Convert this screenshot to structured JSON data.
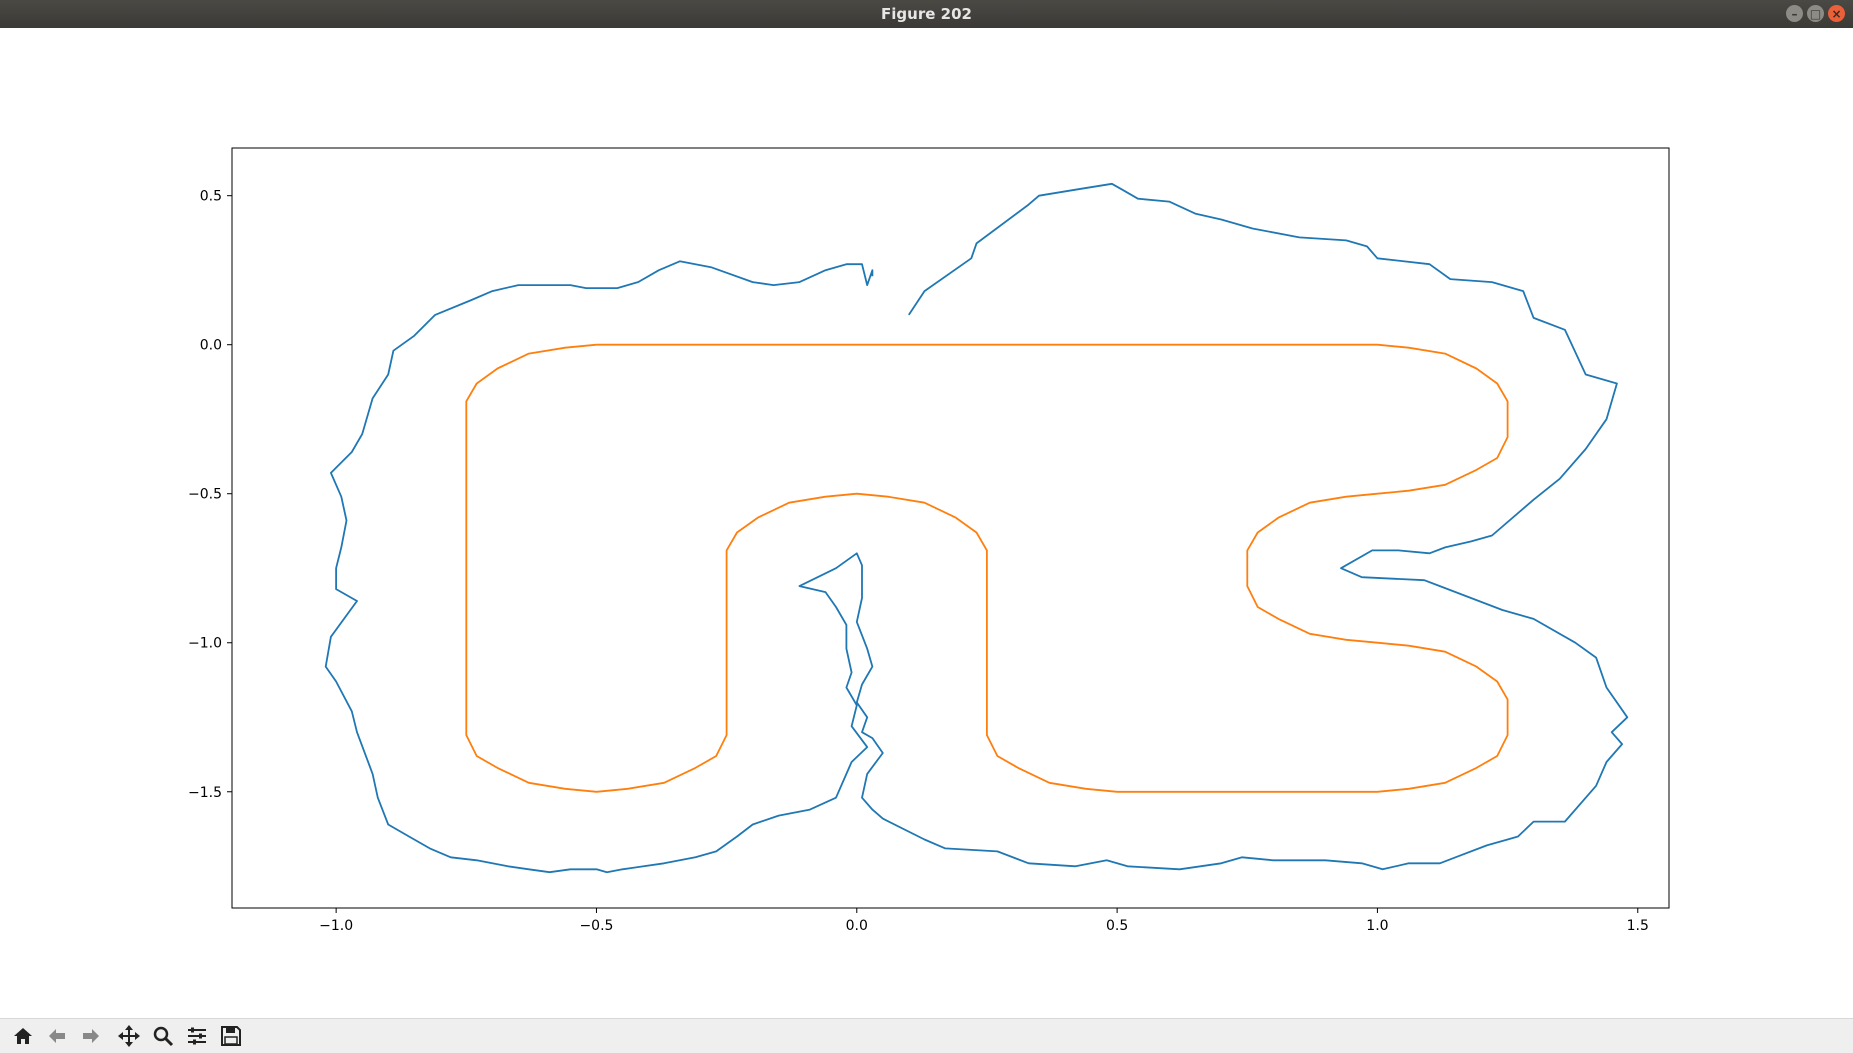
{
  "window": {
    "title": "Figure 202"
  },
  "toolbar": {
    "buttons": [
      {
        "name": "home-icon"
      },
      {
        "name": "back-arrow-icon"
      },
      {
        "name": "forward-arrow-icon"
      },
      {
        "name": "pan-move-icon"
      },
      {
        "name": "zoom-magnifier-icon"
      },
      {
        "name": "configure-subplots-icon"
      },
      {
        "name": "save-figure-icon"
      }
    ]
  },
  "chart_data": {
    "type": "line",
    "title": "",
    "xlabel": "",
    "ylabel": "",
    "xlim": [
      -1.2,
      1.56
    ],
    "ylim": [
      -1.89,
      0.66
    ],
    "xticks": [
      -1.0,
      -0.5,
      0.0,
      0.5,
      1.0,
      1.5
    ],
    "xtick_labels": [
      "−1.0",
      "−0.5",
      "0.0",
      "0.5",
      "1.0",
      "1.5"
    ],
    "yticks": [
      0.5,
      0.0,
      -0.5,
      -1.0,
      -1.5
    ],
    "ytick_labels": [
      "0.5",
      "0.0",
      "−0.5",
      "−1.0",
      "−1.5"
    ],
    "grid": false,
    "series": [
      {
        "color": "#1f77b4",
        "points": [
          [
            0.1,
            0.1
          ],
          [
            0.13,
            0.18
          ],
          [
            0.22,
            0.29
          ],
          [
            0.23,
            0.34
          ],
          [
            0.33,
            0.47
          ],
          [
            0.35,
            0.5
          ],
          [
            0.42,
            0.52
          ],
          [
            0.49,
            0.54
          ],
          [
            0.51,
            0.52
          ],
          [
            0.54,
            0.49
          ],
          [
            0.6,
            0.48
          ],
          [
            0.65,
            0.44
          ],
          [
            0.7,
            0.42
          ],
          [
            0.76,
            0.39
          ],
          [
            0.85,
            0.36
          ],
          [
            0.94,
            0.35
          ],
          [
            0.98,
            0.33
          ],
          [
            1.0,
            0.29
          ],
          [
            1.1,
            0.27
          ],
          [
            1.14,
            0.22
          ],
          [
            1.22,
            0.21
          ],
          [
            1.28,
            0.18
          ],
          [
            1.3,
            0.09
          ],
          [
            1.36,
            0.05
          ],
          [
            1.4,
            -0.1
          ],
          [
            1.46,
            -0.13
          ],
          [
            1.44,
            -0.25
          ],
          [
            1.4,
            -0.35
          ],
          [
            1.35,
            -0.45
          ],
          [
            1.3,
            -0.52
          ],
          [
            1.22,
            -0.64
          ],
          [
            1.18,
            -0.66
          ],
          [
            1.13,
            -0.68
          ],
          [
            1.1,
            -0.7
          ],
          [
            1.04,
            -0.69
          ],
          [
            0.99,
            -0.69
          ],
          [
            0.93,
            -0.75
          ],
          [
            0.97,
            -0.78
          ],
          [
            1.09,
            -0.79
          ],
          [
            1.12,
            -0.81
          ],
          [
            1.24,
            -0.89
          ],
          [
            1.3,
            -0.92
          ],
          [
            1.38,
            -1.0
          ],
          [
            1.42,
            -1.05
          ],
          [
            1.44,
            -1.15
          ],
          [
            1.48,
            -1.25
          ],
          [
            1.45,
            -1.3
          ],
          [
            1.47,
            -1.34
          ],
          [
            1.44,
            -1.4
          ],
          [
            1.42,
            -1.48
          ],
          [
            1.36,
            -1.6
          ],
          [
            1.3,
            -1.6
          ],
          [
            1.27,
            -1.65
          ],
          [
            1.25,
            -1.66
          ],
          [
            1.21,
            -1.68
          ],
          [
            1.15,
            -1.72
          ],
          [
            1.12,
            -1.74
          ],
          [
            1.06,
            -1.74
          ],
          [
            1.01,
            -1.76
          ],
          [
            0.97,
            -1.74
          ],
          [
            0.9,
            -1.73
          ],
          [
            0.8,
            -1.73
          ],
          [
            0.74,
            -1.72
          ],
          [
            0.7,
            -1.74
          ],
          [
            0.62,
            -1.76
          ],
          [
            0.52,
            -1.75
          ],
          [
            0.48,
            -1.73
          ],
          [
            0.42,
            -1.75
          ],
          [
            0.33,
            -1.74
          ],
          [
            0.27,
            -1.7
          ],
          [
            0.17,
            -1.69
          ],
          [
            0.13,
            -1.66
          ],
          [
            0.05,
            -1.59
          ],
          [
            0.03,
            -1.56
          ],
          [
            0.01,
            -1.52
          ],
          [
            0.02,
            -1.44
          ],
          [
            0.05,
            -1.37
          ],
          [
            0.03,
            -1.32
          ],
          [
            0.01,
            -1.3
          ],
          [
            0.02,
            -1.25
          ],
          [
            0.0,
            -1.2
          ],
          [
            0.01,
            -1.14
          ],
          [
            0.03,
            -1.08
          ],
          [
            0.02,
            -1.02
          ],
          [
            0.0,
            -0.93
          ],
          [
            0.01,
            -0.85
          ],
          [
            0.01,
            -0.74
          ],
          [
            0.0,
            -0.7
          ],
          [
            -0.04,
            -0.75
          ],
          [
            -0.11,
            -0.81
          ],
          [
            -0.06,
            -0.83
          ],
          [
            -0.04,
            -0.88
          ],
          [
            -0.02,
            -0.94
          ],
          [
            -0.02,
            -1.02
          ],
          [
            -0.01,
            -1.1
          ],
          [
            -0.02,
            -1.15
          ],
          [
            0.0,
            -1.21
          ],
          [
            -0.01,
            -1.28
          ],
          [
            0.02,
            -1.35
          ],
          [
            -0.01,
            -1.4
          ],
          [
            -0.02,
            -1.44
          ],
          [
            -0.04,
            -1.52
          ],
          [
            -0.09,
            -1.56
          ],
          [
            -0.15,
            -1.58
          ],
          [
            -0.2,
            -1.61
          ],
          [
            -0.23,
            -1.65
          ],
          [
            -0.27,
            -1.7
          ],
          [
            -0.31,
            -1.72
          ],
          [
            -0.37,
            -1.74
          ],
          [
            -0.45,
            -1.76
          ],
          [
            -0.48,
            -1.77
          ],
          [
            -0.5,
            -1.76
          ],
          [
            -0.55,
            -1.76
          ],
          [
            -0.59,
            -1.77
          ],
          [
            -0.63,
            -1.76
          ],
          [
            -0.67,
            -1.75
          ],
          [
            -0.73,
            -1.73
          ],
          [
            -0.78,
            -1.72
          ],
          [
            -0.82,
            -1.69
          ],
          [
            -0.86,
            -1.65
          ],
          [
            -0.9,
            -1.61
          ],
          [
            -0.92,
            -1.52
          ],
          [
            -0.93,
            -1.44
          ],
          [
            -0.96,
            -1.3
          ],
          [
            -0.97,
            -1.23
          ],
          [
            -1.0,
            -1.13
          ],
          [
            -1.02,
            -1.08
          ],
          [
            -1.01,
            -0.98
          ],
          [
            -0.96,
            -0.86
          ],
          [
            -1.0,
            -0.82
          ],
          [
            -1.0,
            -0.75
          ],
          [
            -0.99,
            -0.68
          ],
          [
            -0.98,
            -0.59
          ],
          [
            -0.99,
            -0.51
          ],
          [
            -1.01,
            -0.43
          ],
          [
            -0.97,
            -0.36
          ],
          [
            -0.95,
            -0.3
          ],
          [
            -0.93,
            -0.18
          ],
          [
            -0.9,
            -0.1
          ],
          [
            -0.89,
            -0.02
          ],
          [
            -0.85,
            0.03
          ],
          [
            -0.81,
            0.1
          ],
          [
            -0.74,
            0.15
          ],
          [
            -0.7,
            0.18
          ],
          [
            -0.65,
            0.2
          ],
          [
            -0.55,
            0.2
          ],
          [
            -0.52,
            0.19
          ],
          [
            -0.46,
            0.19
          ],
          [
            -0.42,
            0.21
          ],
          [
            -0.38,
            0.25
          ],
          [
            -0.34,
            0.28
          ],
          [
            -0.28,
            0.26
          ],
          [
            -0.2,
            0.21
          ],
          [
            -0.16,
            0.2
          ],
          [
            -0.11,
            0.21
          ],
          [
            -0.06,
            0.25
          ],
          [
            -0.02,
            0.27
          ],
          [
            0.01,
            0.27
          ],
          [
            0.02,
            0.2
          ],
          [
            0.03,
            0.25
          ],
          [
            0.03,
            0.23
          ]
        ]
      },
      {
        "color": "#ff7f0e",
        "points": [
          [
            -0.5,
            0.0
          ],
          [
            1.0,
            0.0
          ],
          [
            1.06,
            -0.01
          ],
          [
            1.13,
            -0.03
          ],
          [
            1.19,
            -0.08
          ],
          [
            1.23,
            -0.13
          ],
          [
            1.25,
            -0.19
          ],
          [
            1.25,
            -0.25
          ],
          [
            1.25,
            -0.31
          ],
          [
            1.23,
            -0.38
          ],
          [
            1.19,
            -0.42
          ],
          [
            1.13,
            -0.47
          ],
          [
            1.06,
            -0.49
          ],
          [
            1.0,
            -0.5
          ],
          [
            0.94,
            -0.51
          ],
          [
            0.87,
            -0.53
          ],
          [
            0.81,
            -0.58
          ],
          [
            0.77,
            -0.63
          ],
          [
            0.75,
            -0.69
          ],
          [
            0.75,
            -0.75
          ],
          [
            0.75,
            -0.81
          ],
          [
            0.77,
            -0.88
          ],
          [
            0.81,
            -0.92
          ],
          [
            0.87,
            -0.97
          ],
          [
            0.94,
            -0.99
          ],
          [
            1.0,
            -1.0
          ],
          [
            1.06,
            -1.01
          ],
          [
            1.13,
            -1.03
          ],
          [
            1.19,
            -1.08
          ],
          [
            1.23,
            -1.13
          ],
          [
            1.25,
            -1.19
          ],
          [
            1.25,
            -1.25
          ],
          [
            1.25,
            -1.31
          ],
          [
            1.23,
            -1.38
          ],
          [
            1.19,
            -1.42
          ],
          [
            1.13,
            -1.47
          ],
          [
            1.06,
            -1.49
          ],
          [
            1.0,
            -1.5
          ],
          [
            0.5,
            -1.5
          ],
          [
            0.44,
            -1.49
          ],
          [
            0.37,
            -1.47
          ],
          [
            0.31,
            -1.42
          ],
          [
            0.27,
            -1.38
          ],
          [
            0.25,
            -1.31
          ],
          [
            0.25,
            -1.25
          ],
          [
            0.25,
            -0.75
          ],
          [
            0.25,
            -0.69
          ],
          [
            0.23,
            -0.63
          ],
          [
            0.19,
            -0.58
          ],
          [
            0.13,
            -0.53
          ],
          [
            0.06,
            -0.51
          ],
          [
            0.0,
            -0.5
          ],
          [
            -0.06,
            -0.51
          ],
          [
            -0.13,
            -0.53
          ],
          [
            -0.19,
            -0.58
          ],
          [
            -0.23,
            -0.63
          ],
          [
            -0.25,
            -0.69
          ],
          [
            -0.25,
            -0.75
          ],
          [
            -0.25,
            -1.25
          ],
          [
            -0.25,
            -1.31
          ],
          [
            -0.27,
            -1.38
          ],
          [
            -0.31,
            -1.42
          ],
          [
            -0.37,
            -1.47
          ],
          [
            -0.44,
            -1.49
          ],
          [
            -0.5,
            -1.5
          ],
          [
            -0.56,
            -1.49
          ],
          [
            -0.63,
            -1.47
          ],
          [
            -0.69,
            -1.42
          ],
          [
            -0.73,
            -1.38
          ],
          [
            -0.75,
            -1.31
          ],
          [
            -0.75,
            -1.25
          ],
          [
            -0.75,
            -0.25
          ],
          [
            -0.75,
            -0.19
          ],
          [
            -0.73,
            -0.13
          ],
          [
            -0.69,
            -0.08
          ],
          [
            -0.63,
            -0.03
          ],
          [
            -0.56,
            -0.01
          ],
          [
            -0.5,
            0.0
          ]
        ]
      }
    ]
  }
}
